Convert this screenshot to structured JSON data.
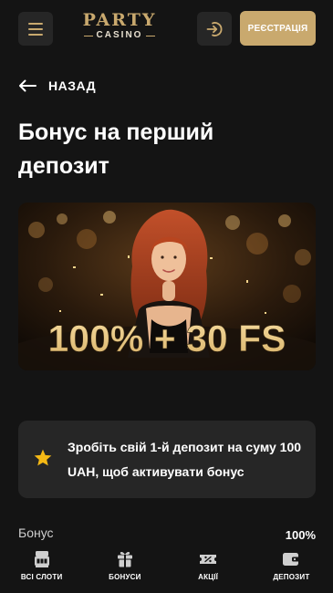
{
  "header": {
    "logo_top": "PARTY",
    "logo_bottom": "CASINO",
    "register_label": "РЕЄСТРАЦІЯ"
  },
  "back_label": "НАЗАД",
  "page_title": "Бонус на перший депозит",
  "banner": {
    "headline": "100% + 30 FS"
  },
  "info_card": {
    "text": "Зробіть свій 1-й депозит на суму 100 UAH, щоб активувати бонус"
  },
  "bonus_row": {
    "label": "Бонус",
    "value": "100%"
  },
  "bottom_nav": [
    {
      "label": "ВСІ СЛОТИ",
      "icon": "slot-machine-icon"
    },
    {
      "label": "БОНУСИ",
      "icon": "gift-icon"
    },
    {
      "label": "АКЦІЇ",
      "icon": "promo-ticket-icon"
    },
    {
      "label": "ДЕПОЗИТ",
      "icon": "wallet-icon"
    }
  ],
  "colors": {
    "background": "#141414",
    "surface": "#262626",
    "accent_gold": "#c9a96e",
    "star": "#f5b915"
  }
}
